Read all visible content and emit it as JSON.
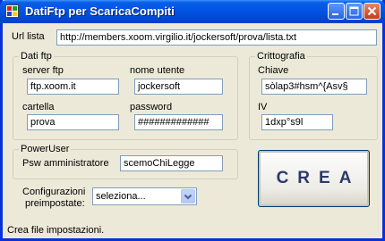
{
  "window": {
    "title": "DatiFtp per ScaricaCompiti"
  },
  "url": {
    "label": "Url lista",
    "value": "http://members.xoom.virgilio.it/jockersoft/prova/lista.txt"
  },
  "ftp": {
    "group_title": "Dati ftp",
    "server_label": "server ftp",
    "server_value": "ftp.xoom.it",
    "user_label": "nome utente",
    "user_value": "jockersoft",
    "folder_label": "cartella",
    "folder_value": "prova",
    "password_label": "password",
    "password_value": "#############"
  },
  "crypto": {
    "group_title": "Crittografia",
    "key_label": "Chiave",
    "key_value": "sòlap3#hsm^{Asv§",
    "iv_label": "IV",
    "iv_value": "1dxp°s9l"
  },
  "poweruser": {
    "group_title": "PowerUser",
    "admin_label": "Psw amministratore",
    "admin_value": "scemoChiLegge"
  },
  "presets": {
    "label_line1": "Configurazioni",
    "label_line2": "preimpostate:",
    "selected": "seleziona..."
  },
  "buttons": {
    "create": "CREA"
  },
  "status": {
    "text": "Crea file impostazioni."
  },
  "icons": {
    "app": "app-icon",
    "minimize": "minimize-icon",
    "maximize": "maximize-icon",
    "close": "close-icon",
    "dropdown": "chevron-down-icon"
  }
}
